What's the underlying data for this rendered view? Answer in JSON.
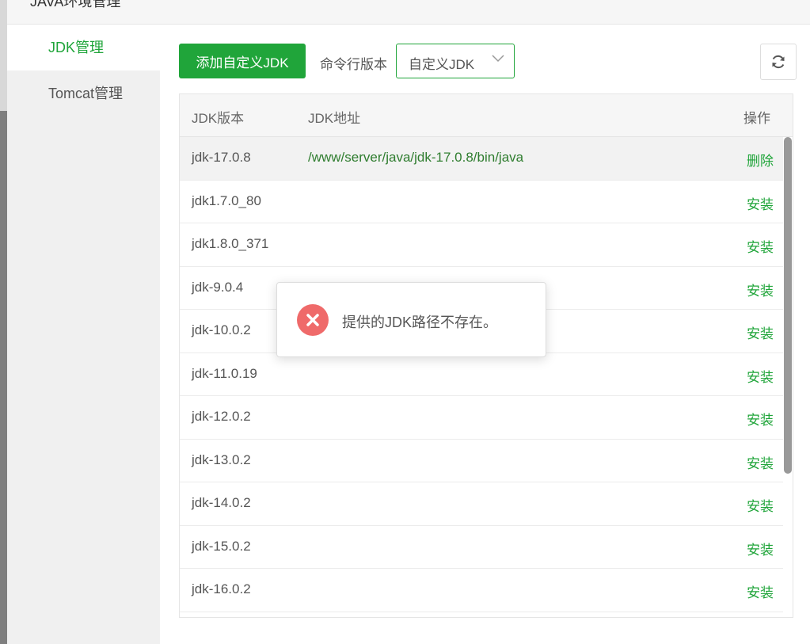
{
  "window": {
    "title": "JAVA环境管理"
  },
  "sidebar": {
    "items": [
      {
        "label": "JDK管理",
        "active": true
      },
      {
        "label": "Tomcat管理",
        "active": false
      }
    ]
  },
  "toolbar": {
    "add_button": "添加自定义JDK",
    "cli_label": "命令行版本",
    "cli_select_value": "自定义JDK"
  },
  "table": {
    "headers": {
      "version": "JDK版本",
      "path": "JDK地址",
      "action": "操作"
    },
    "rows": [
      {
        "version": "jdk-17.0.8",
        "path": "/www/server/java/jdk-17.0.8/bin/java",
        "action": "删除"
      },
      {
        "version": "jdk1.7.0_80",
        "path": "",
        "action": "安装"
      },
      {
        "version": "jdk1.8.0_371",
        "path": "",
        "action": "安装"
      },
      {
        "version": "jdk-9.0.4",
        "path": "",
        "action": "安装"
      },
      {
        "version": "jdk-10.0.2",
        "path": "",
        "action": "安装"
      },
      {
        "version": "jdk-11.0.19",
        "path": "",
        "action": "安装"
      },
      {
        "version": "jdk-12.0.2",
        "path": "",
        "action": "安装"
      },
      {
        "version": "jdk-13.0.2",
        "path": "",
        "action": "安装"
      },
      {
        "version": "jdk-14.0.2",
        "path": "",
        "action": "安装"
      },
      {
        "version": "jdk-15.0.2",
        "path": "",
        "action": "安装"
      },
      {
        "version": "jdk-16.0.2",
        "path": "",
        "action": "安装"
      }
    ]
  },
  "toast": {
    "message": "提供的JDK路径不存在。",
    "icon": "error-icon"
  },
  "colors": {
    "accent": "#20a53a",
    "error": "#ef6a6a"
  }
}
